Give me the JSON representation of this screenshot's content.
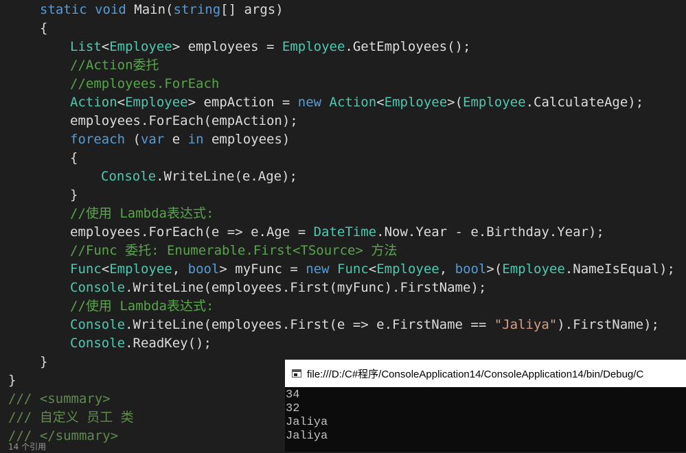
{
  "editor": {
    "lines": [
      [
        [
          "kw",
          "static"
        ],
        [
          "pl",
          " "
        ],
        [
          "kw",
          "void"
        ],
        [
          "pl",
          " Main("
        ],
        [
          "kw",
          "string"
        ],
        [
          "pl",
          "[] args)"
        ]
      ],
      [
        [
          "pl",
          "{"
        ]
      ],
      [
        [
          "ty",
          "List"
        ],
        [
          "pl",
          "<"
        ],
        [
          "ty",
          "Employee"
        ],
        [
          "pl",
          "> employees = "
        ],
        [
          "ty",
          "Employee"
        ],
        [
          "pl",
          ".GetEmployees();"
        ]
      ],
      [
        [
          "cm",
          "//Action委托"
        ]
      ],
      [
        [
          "cm",
          "//employees.ForEach"
        ]
      ],
      [
        [
          "ty",
          "Action"
        ],
        [
          "pl",
          "<"
        ],
        [
          "ty",
          "Employee"
        ],
        [
          "pl",
          "> empAction = "
        ],
        [
          "kw",
          "new"
        ],
        [
          "pl",
          " "
        ],
        [
          "ty",
          "Action"
        ],
        [
          "pl",
          "<"
        ],
        [
          "ty",
          "Employee"
        ],
        [
          "pl",
          ">("
        ],
        [
          "ty",
          "Employee"
        ],
        [
          "pl",
          ".CalculateAge);"
        ]
      ],
      [
        [
          "pl",
          "employees.ForEach(empAction);"
        ]
      ],
      [
        [
          "kw",
          "foreach"
        ],
        [
          "pl",
          " ("
        ],
        [
          "kw",
          "var"
        ],
        [
          "pl",
          " e "
        ],
        [
          "kw",
          "in"
        ],
        [
          "pl",
          " employees)"
        ]
      ],
      [
        [
          "pl",
          "{"
        ]
      ],
      [
        [
          "ty",
          "Console"
        ],
        [
          "pl",
          ".WriteLine(e.Age);"
        ]
      ],
      [
        [
          "pl",
          "}"
        ]
      ],
      [
        [
          "cm",
          "//使用 Lambda表达式:"
        ]
      ],
      [
        [
          "pl",
          "employees.ForEach(e => e.Age = "
        ],
        [
          "ty",
          "DateTime"
        ],
        [
          "pl",
          ".Now.Year - e.Birthday.Year);"
        ]
      ],
      [
        [
          "cm",
          "//Func 委托: Enumerable.First<TSource> 方法"
        ]
      ],
      [
        [
          "ty",
          "Func"
        ],
        [
          "pl",
          "<"
        ],
        [
          "ty",
          "Employee"
        ],
        [
          "pl",
          ", "
        ],
        [
          "kw",
          "bool"
        ],
        [
          "pl",
          "> myFunc = "
        ],
        [
          "kw",
          "new"
        ],
        [
          "pl",
          " "
        ],
        [
          "ty",
          "Func"
        ],
        [
          "pl",
          "<"
        ],
        [
          "ty",
          "Employee"
        ],
        [
          "pl",
          ", "
        ],
        [
          "kw",
          "bool"
        ],
        [
          "pl",
          ">("
        ],
        [
          "ty",
          "Employee"
        ],
        [
          "pl",
          ".NameIsEqual);"
        ]
      ],
      [
        [
          "ty",
          "Console"
        ],
        [
          "pl",
          ".WriteLine(employees.First(myFunc).FirstName);"
        ]
      ],
      [
        [
          "cm",
          "//使用 Lambda表达式:"
        ]
      ],
      [
        [
          "ty",
          "Console"
        ],
        [
          "pl",
          ".WriteLine(employees.First(e => e.FirstName == "
        ],
        [
          "str",
          "\"Jaliya\""
        ],
        [
          "pl",
          ").FirstName);"
        ]
      ],
      [
        [
          "ty",
          "Console"
        ],
        [
          "pl",
          ".ReadKey();"
        ]
      ],
      [
        [
          "pl",
          "}"
        ]
      ],
      [
        [
          "pl",
          "}"
        ]
      ],
      [
        [
          "doc",
          "/// <summary>"
        ]
      ],
      [
        [
          "doc",
          "/// 自定义 员工 类"
        ]
      ],
      [
        [
          "doc",
          "/// </summary>"
        ]
      ],
      [
        [
          "ref",
          "14 个引用"
        ]
      ]
    ]
  },
  "console": {
    "title": "file:///D:/C#程序/ConsoleApplication14/ConsoleApplication14/bin/Debug/C",
    "output": [
      "34",
      "32",
      "Jaliya",
      "Jaliya"
    ]
  }
}
